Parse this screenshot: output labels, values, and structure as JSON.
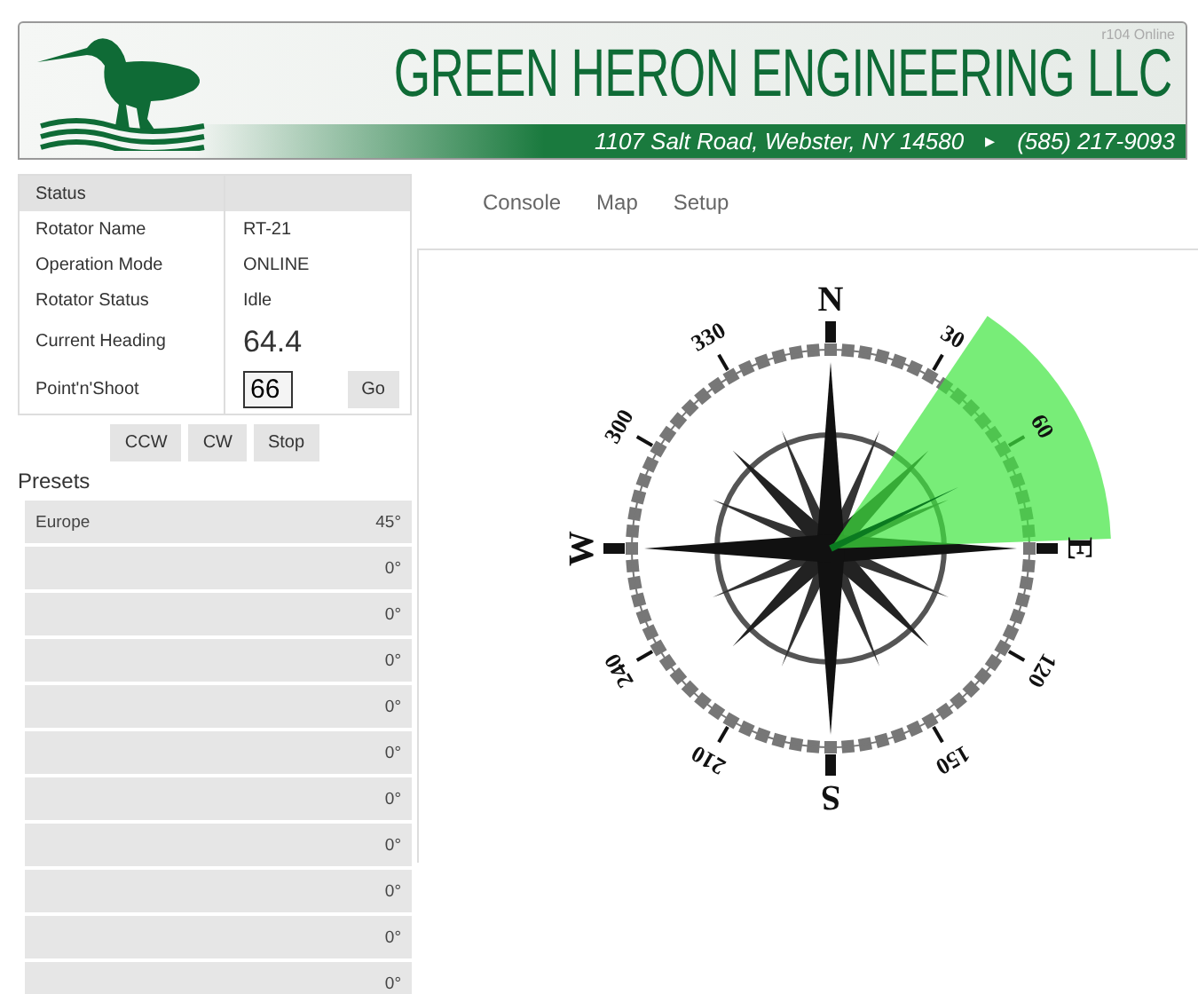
{
  "header": {
    "badge": "r104 Online",
    "title": "GREEN HERON ENGINEERING LLC",
    "address": "1107 Salt Road, Webster, NY 14580",
    "separator": "▸",
    "phone": "(585) 217-9093"
  },
  "status": {
    "heading": "Status",
    "rows": [
      {
        "kind": "text",
        "label": "Rotator Name",
        "value": "RT-21"
      },
      {
        "kind": "text",
        "label": "Operation Mode",
        "value": "ONLINE"
      },
      {
        "kind": "text",
        "label": "Rotator Status",
        "value": "Idle"
      },
      {
        "kind": "big",
        "label": "Current Heading",
        "value": "64.4"
      },
      {
        "kind": "input",
        "label": "Point'n'Shoot",
        "value": "66",
        "button": "Go"
      }
    ]
  },
  "controls": [
    "CCW",
    "CW",
    "Stop"
  ],
  "presets": {
    "title": "Presets",
    "items": [
      {
        "name": "Europe",
        "angle": "45°"
      },
      {
        "angle": "0°"
      },
      {
        "angle": "0°"
      },
      {
        "angle": "0°"
      },
      {
        "angle": "0°"
      },
      {
        "angle": "0°"
      },
      {
        "angle": "0°"
      },
      {
        "angle": "0°"
      },
      {
        "angle": "0°"
      },
      {
        "angle": "0°"
      },
      {
        "angle": "0°"
      }
    ]
  },
  "tabs": [
    {
      "label": "Console"
    },
    {
      "label": "Map"
    },
    {
      "label": "Setup"
    }
  ],
  "compass": {
    "cardinals": [
      "N",
      "E",
      "S",
      "W"
    ],
    "degree_labels": [
      "30",
      "60",
      "120",
      "150",
      "210",
      "240",
      "300",
      "330"
    ]
  }
}
